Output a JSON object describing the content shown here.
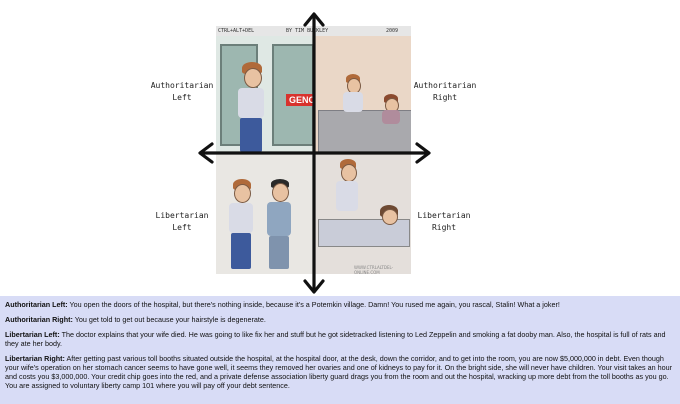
{
  "comic": {
    "header_left": "CTRL+ALT+DEL",
    "header_mid": "BY TIM BUCKLEY",
    "header_right": "2009",
    "sign_text": "GENC",
    "watermark": "WWW.CTRLALTDEL-ONLINE.COM"
  },
  "quadrants": {
    "auth_left": "Authoritarian\nLeft",
    "auth_right": "Authoritarian\nRight",
    "lib_left": "Libertarian\nLeft",
    "lib_right": "Libertarian\nRight"
  },
  "captions": [
    {
      "label": "Authoritarian Left:",
      "text": " You open the doors of the hospital, but there's nothing inside, because it's a Potemkin village. Damn! You rused me again, you rascal, Stalin! What a joker!"
    },
    {
      "label": "Authoritarian Right:",
      "text": " You get told to get out because your hairstyle is degenerate."
    },
    {
      "label": "Libertarian Left:",
      "text": " The doctor explains that your wife died. He was going to like fix her and stuff but he got sidetracked listening to Led Zeppelin and smoking a fat dooby man. Also, the hospital is full of rats and they ate her body."
    },
    {
      "label": "Libertarian Right:",
      "text": " After getting past various toll booths situated outside the hospital, at the hospital door, at the desk, down the corridor, and to get into the room, you are now $5,000,000 in debt. Even though your wife's operation on her stomach cancer seems to have gone well, it seems they removed her ovaries and one of kidneys to pay for it. On the bright side, she will never have children. Your visit takes an hour and costs you $3,000,000. Your credit chip goes into the red, and a private defense association liberty guard drags you from the room and out the hospital, wracking up more debt from the toll booths as you go. You are assigned to voluntary liberty camp 101 where you will pay off your debt sentence."
    }
  ]
}
